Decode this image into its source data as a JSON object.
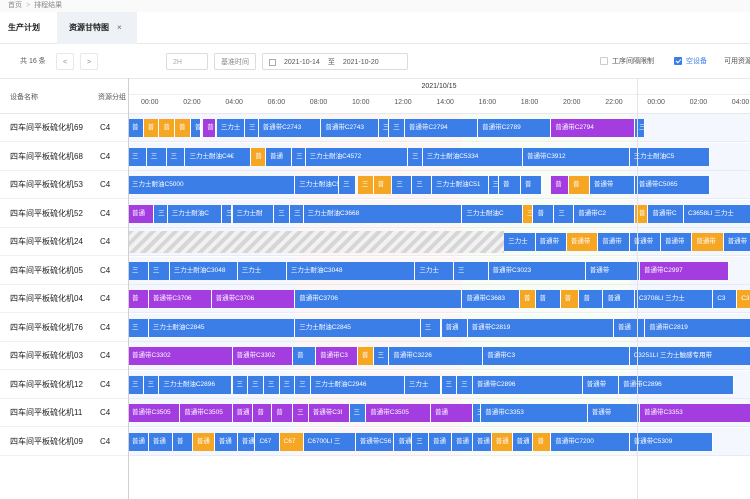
{
  "breadcrumb": {
    "home": "首页",
    "sep": ">",
    "current": "排程结果"
  },
  "tabs": [
    {
      "label": "生产计划"
    },
    {
      "label": "资源甘特图",
      "close": "×"
    }
  ],
  "toolbar": {
    "total": "共 16 条",
    "prev": "<",
    "next": ">",
    "unit": "2H",
    "base_time": "基准时间",
    "date_from": "2021-10-14",
    "to": "至",
    "date_to": "2021-10-20",
    "opt1": "工序间隔限制",
    "opt2": "空设备",
    "opt3": "可用资源"
  },
  "header": {
    "col_device": "设备名称",
    "col_group": "资源分组",
    "date": "2021/10/15",
    "hours": [
      "00:00",
      "02:00",
      "04:00",
      "06:00",
      "08:00",
      "10:00",
      "12:00",
      "14:00",
      "16:00",
      "18:00",
      "20:00",
      "22:00",
      "00:00",
      "02:00",
      "04:00"
    ]
  },
  "colors": {
    "blue": "#3b7ee8",
    "orange": "#f5a623",
    "purple": "#a43de0",
    "bg_blue": "#cfe0fb",
    "bg_pink": "#f8d8da",
    "bg_green": "#d9f0d6"
  },
  "rows": [
    {
      "device": "四车间平板硫化机69",
      "group": "C4",
      "bars": [
        {
          "s": 0,
          "e": 1.5,
          "c": "blue",
          "t": "普"
        },
        {
          "s": 1.5,
          "e": 3,
          "c": "orange",
          "t": "普"
        },
        {
          "s": 3,
          "e": 4.5,
          "c": "orange",
          "t": "普"
        },
        {
          "s": 4.5,
          "e": 6,
          "c": "orange",
          "t": "普"
        },
        {
          "s": 6,
          "e": 7,
          "c": "blue",
          "t": "普"
        },
        {
          "s": 7.2,
          "e": 8.4,
          "c": "purple",
          "t": "普"
        },
        {
          "s": 8.5,
          "e": 11.2,
          "c": "blue",
          "t": "三力士"
        },
        {
          "s": 11.2,
          "e": 12.5,
          "c": "blue",
          "t": "三"
        },
        {
          "s": 12.5,
          "e": 18.5,
          "c": "blue",
          "t": "普通带C2743"
        },
        {
          "s": 18.5,
          "e": 24,
          "c": "blue",
          "t": "普通带C2743"
        },
        {
          "s": 24,
          "e": 25,
          "c": "blue",
          "t": "三"
        },
        {
          "s": 25,
          "e": 26.5,
          "c": "blue",
          "t": "三"
        },
        {
          "s": 26.5,
          "e": 33.5,
          "c": "blue",
          "t": "普通带C2794"
        },
        {
          "s": 33.5,
          "e": 40.5,
          "c": "blue",
          "t": "普通带C2789"
        },
        {
          "s": 40.5,
          "e": 48.5,
          "c": "purple",
          "t": "普通带C2794"
        },
        {
          "s": 48.5,
          "e": 49.5,
          "c": "blue",
          "t": "三"
        }
      ]
    },
    {
      "device": "四车间平板硫化机68",
      "group": "C4",
      "bars": [
        {
          "s": 0,
          "e": 1.8,
          "c": "blue",
          "t": "三"
        },
        {
          "s": 1.8,
          "e": 3.7,
          "c": "blue",
          "t": "三"
        },
        {
          "s": 3.7,
          "e": 5.5,
          "c": "blue",
          "t": "三"
        },
        {
          "s": 5.5,
          "e": 11.8,
          "c": "blue",
          "t": "三力士耐油C4€"
        },
        {
          "s": 11.8,
          "e": 13.2,
          "c": "orange",
          "t": "普"
        },
        {
          "s": 13.2,
          "e": 15.7,
          "c": "blue",
          "t": "普通"
        },
        {
          "s": 15.7,
          "e": 17,
          "c": "blue",
          "t": "三"
        },
        {
          "s": 17,
          "e": 26.8,
          "c": "blue",
          "t": "三力士耐油C4572"
        },
        {
          "s": 26.8,
          "e": 28.2,
          "c": "blue",
          "t": "三"
        },
        {
          "s": 28.2,
          "e": 37.8,
          "c": "blue",
          "t": "三力士耐油C5334"
        },
        {
          "s": 37.8,
          "e": 48,
          "c": "blue",
          "t": "普通带C3912"
        },
        {
          "s": 48,
          "e": 55.7,
          "c": "blue",
          "t": "三力士耐油C5"
        }
      ]
    },
    {
      "device": "四车间平板硫化机53",
      "group": "C4",
      "bars": [
        {
          "s": 0,
          "e": 16,
          "c": "blue",
          "t": "三力士耐油C5000"
        },
        {
          "s": 16,
          "e": 20.2,
          "c": "blue",
          "t": "三力士耐油C50"
        },
        {
          "s": 20.2,
          "e": 21.8,
          "c": "blue",
          "t": "三"
        },
        {
          "s": 22,
          "e": 23.5,
          "c": "orange",
          "t": "三"
        },
        {
          "s": 23.5,
          "e": 25.3,
          "c": "orange",
          "t": "普"
        },
        {
          "s": 25.3,
          "e": 27.2,
          "c": "blue",
          "t": "三"
        },
        {
          "s": 27.2,
          "e": 29.1,
          "c": "blue",
          "t": "三"
        },
        {
          "s": 29.1,
          "e": 34.5,
          "c": "blue",
          "t": "三力士耐油C51"
        },
        {
          "s": 34.5,
          "e": 35.5,
          "c": "blue",
          "t": "三"
        },
        {
          "s": 35.5,
          "e": 37.6,
          "c": "blue",
          "t": "普"
        },
        {
          "s": 37.6,
          "e": 39.6,
          "c": "blue",
          "t": "普"
        },
        {
          "s": 40.5,
          "e": 42.2,
          "c": "purple",
          "t": "普"
        },
        {
          "s": 42.2,
          "e": 44.2,
          "c": "orange",
          "t": "普"
        },
        {
          "s": 44.2,
          "e": 48.5,
          "c": "blue",
          "t": "普通带"
        },
        {
          "s": 48.5,
          "e": 55.7,
          "c": "blue",
          "t": "普通带C5065"
        }
      ]
    },
    {
      "device": "四车间平板硫化机52",
      "group": "C4",
      "bars": [
        {
          "s": 0,
          "e": 2.5,
          "c": "purple",
          "t": "普通"
        },
        {
          "s": 2.5,
          "e": 3.8,
          "c": "blue",
          "t": "三"
        },
        {
          "s": 3.8,
          "e": 9,
          "c": "blue",
          "t": "三力士耐油C"
        },
        {
          "s": 9,
          "e": 10,
          "c": "blue",
          "t": "三"
        },
        {
          "s": 10,
          "e": 14,
          "c": "blue",
          "t": "三力士耐"
        },
        {
          "s": 14,
          "e": 15.5,
          "c": "blue",
          "t": "三"
        },
        {
          "s": 15.5,
          "e": 16.8,
          "c": "blue",
          "t": "三"
        },
        {
          "s": 16.8,
          "e": 32,
          "c": "blue",
          "t": "三力士耐油C3668"
        },
        {
          "s": 32,
          "e": 37.8,
          "c": "blue",
          "t": "三力士耐油C"
        },
        {
          "s": 37.8,
          "e": 38.8,
          "c": "orange",
          "t": "三"
        },
        {
          "s": 38.8,
          "e": 40.8,
          "c": "blue",
          "t": "普"
        },
        {
          "s": 40.8,
          "e": 42.7,
          "c": "blue",
          "t": "三"
        },
        {
          "s": 42.7,
          "e": 48.5,
          "c": "blue",
          "t": "普通带C2"
        },
        {
          "s": 48.5,
          "e": 49.8,
          "c": "orange",
          "t": "普"
        },
        {
          "s": 49.8,
          "e": 53.2,
          "c": "blue",
          "t": "普通带C"
        },
        {
          "s": 53.2,
          "e": 61,
          "c": "blue",
          "t": "C3658LI 三力士"
        }
      ]
    },
    {
      "device": "四车间平板硫化机24",
      "group": "C4",
      "hatch": [
        0,
        36
      ],
      "bars": [
        {
          "s": 36,
          "e": 39,
          "c": "blue",
          "t": "三力士"
        },
        {
          "s": 39,
          "e": 42,
          "c": "blue",
          "t": "普通带"
        },
        {
          "s": 42,
          "e": 45,
          "c": "orange",
          "t": "普通带"
        },
        {
          "s": 45,
          "e": 48,
          "c": "blue",
          "t": "普通带"
        },
        {
          "s": 48,
          "e": 51,
          "c": "blue",
          "t": "普通带"
        },
        {
          "s": 51,
          "e": 54,
          "c": "blue",
          "t": "普通带"
        },
        {
          "s": 54,
          "e": 57,
          "c": "orange",
          "t": "普通带"
        },
        {
          "s": 57,
          "e": 60,
          "c": "blue",
          "t": "普通带"
        }
      ]
    },
    {
      "device": "四车间平板硫化机05",
      "group": "C4",
      "bars": [
        {
          "s": 0,
          "e": 2,
          "c": "blue",
          "t": "三"
        },
        {
          "s": 2,
          "e": 4,
          "c": "blue",
          "t": "三"
        },
        {
          "s": 4,
          "e": 10.5,
          "c": "blue",
          "t": "三力士耐油C3048"
        },
        {
          "s": 10.5,
          "e": 15.2,
          "c": "blue",
          "t": "三力士"
        },
        {
          "s": 15.2,
          "e": 27.5,
          "c": "blue",
          "t": "三力士耐油C3048"
        },
        {
          "s": 27.5,
          "e": 31.2,
          "c": "blue",
          "t": "三力士"
        },
        {
          "s": 31.2,
          "e": 34.5,
          "c": "blue",
          "t": "三"
        },
        {
          "s": 34.5,
          "e": 43.8,
          "c": "blue",
          "t": "普通带C3023"
        },
        {
          "s": 43.8,
          "e": 49,
          "c": "blue",
          "t": "普通带"
        },
        {
          "s": 49,
          "e": 57.5,
          "c": "purple",
          "t": "普通带C2997"
        }
      ]
    },
    {
      "device": "四车间平板硫化机04",
      "group": "C4",
      "bars": [
        {
          "s": 0,
          "e": 2,
          "c": "purple",
          "t": "普"
        },
        {
          "s": 2,
          "e": 8,
          "c": "purple",
          "t": "普通带C3706"
        },
        {
          "s": 8,
          "e": 16,
          "c": "purple",
          "t": "普通带C3706"
        },
        {
          "s": 16,
          "e": 32,
          "c": "blue",
          "t": "普通带C3706"
        },
        {
          "s": 32,
          "e": 37.5,
          "c": "blue",
          "t": "普通带C3683"
        },
        {
          "s": 37.5,
          "e": 39,
          "c": "orange",
          "t": "普"
        },
        {
          "s": 39,
          "e": 41.4,
          "c": "blue",
          "t": "普"
        },
        {
          "s": 41.4,
          "e": 43.2,
          "c": "orange",
          "t": "普"
        },
        {
          "s": 43.2,
          "e": 45.5,
          "c": "blue",
          "t": "普"
        },
        {
          "s": 45.5,
          "e": 48.5,
          "c": "blue",
          "t": "普通"
        },
        {
          "s": 48.5,
          "e": 56,
          "c": "blue",
          "t": "C3708LI 三力士"
        },
        {
          "s": 56,
          "e": 58.3,
          "c": "blue",
          "t": "C3"
        },
        {
          "s": 58.3,
          "e": 61,
          "c": "orange",
          "t": "C3"
        }
      ]
    },
    {
      "device": "四车间平板硫化机76",
      "group": "C4",
      "bars": [
        {
          "s": 0,
          "e": 2,
          "c": "blue",
          "t": "三"
        },
        {
          "s": 2,
          "e": 16,
          "c": "blue",
          "t": "三力士耐油C2845"
        },
        {
          "s": 16,
          "e": 28,
          "c": "blue",
          "t": "三力士耐油C2845"
        },
        {
          "s": 28,
          "e": 30,
          "c": "blue",
          "t": "三"
        },
        {
          "s": 30,
          "e": 32.5,
          "c": "blue",
          "t": "普通"
        },
        {
          "s": 32.5,
          "e": 46.5,
          "c": "blue",
          "t": "普通带C2819"
        },
        {
          "s": 46.5,
          "e": 49.5,
          "c": "blue",
          "t": "普通"
        },
        {
          "s": 49.5,
          "e": 61,
          "c": "blue",
          "t": "普通带C2819"
        }
      ]
    },
    {
      "device": "四车间平板硫化机03",
      "group": "C4",
      "bars": [
        {
          "s": 0,
          "e": 10,
          "c": "purple",
          "t": "普通带C3302"
        },
        {
          "s": 10,
          "e": 15.8,
          "c": "purple",
          "t": "普通带C3302"
        },
        {
          "s": 15.8,
          "e": 18,
          "c": "blue",
          "t": "普"
        },
        {
          "s": 18,
          "e": 22,
          "c": "purple",
          "t": "普通带C3"
        },
        {
          "s": 22,
          "e": 23.5,
          "c": "orange",
          "t": "普"
        },
        {
          "s": 23.5,
          "e": 25,
          "c": "blue",
          "t": "三"
        },
        {
          "s": 25,
          "e": 34,
          "c": "blue",
          "t": "普通带C3226"
        },
        {
          "s": 34,
          "e": 48,
          "c": "blue",
          "t": "普通带C3"
        },
        {
          "s": 48,
          "e": 61,
          "c": "blue",
          "t": "C3251LI 三力士触感专用带"
        }
      ]
    },
    {
      "device": "四车间平板硫化机12",
      "group": "C4",
      "bars": [
        {
          "s": 0,
          "e": 1.5,
          "c": "blue",
          "t": "三"
        },
        {
          "s": 1.5,
          "e": 3,
          "c": "blue",
          "t": "三"
        },
        {
          "s": 3,
          "e": 10,
          "c": "blue",
          "t": "三力士耐油C2896"
        },
        {
          "s": 10,
          "e": 11.5,
          "c": "blue",
          "t": "三"
        },
        {
          "s": 11.5,
          "e": 13,
          "c": "blue",
          "t": "三"
        },
        {
          "s": 13,
          "e": 14.5,
          "c": "blue",
          "t": "三"
        },
        {
          "s": 14.5,
          "e": 16,
          "c": "blue",
          "t": "三"
        },
        {
          "s": 16,
          "e": 17.5,
          "c": "blue",
          "t": "三"
        },
        {
          "s": 17.5,
          "e": 26.5,
          "c": "blue",
          "t": "三力士耐油C2946"
        },
        {
          "s": 26.5,
          "e": 30,
          "c": "blue",
          "t": "三力士"
        },
        {
          "s": 30,
          "e": 31.5,
          "c": "blue",
          "t": "三"
        },
        {
          "s": 31.5,
          "e": 33,
          "c": "blue",
          "t": "三"
        },
        {
          "s": 33,
          "e": 43.5,
          "c": "blue",
          "t": "普通带C2896"
        },
        {
          "s": 43.5,
          "e": 47,
          "c": "blue",
          "t": "普通带"
        },
        {
          "s": 47,
          "e": 58,
          "c": "blue",
          "t": "普通带C2896"
        }
      ]
    },
    {
      "device": "四车间平板硫化机11",
      "group": "C4",
      "bars": [
        {
          "s": 0,
          "e": 5,
          "c": "purple",
          "t": "普通带C3505"
        },
        {
          "s": 5,
          "e": 10,
          "c": "purple",
          "t": "普通带C3505"
        },
        {
          "s": 10,
          "e": 12,
          "c": "purple",
          "t": "普通"
        },
        {
          "s": 12,
          "e": 13.8,
          "c": "purple",
          "t": "普"
        },
        {
          "s": 13.8,
          "e": 15.8,
          "c": "purple",
          "t": "普"
        },
        {
          "s": 15.8,
          "e": 17.3,
          "c": "purple",
          "t": "三"
        },
        {
          "s": 17.3,
          "e": 21.2,
          "c": "purple",
          "t": "普通带C3I"
        },
        {
          "s": 21.2,
          "e": 22.8,
          "c": "blue",
          "t": "三"
        },
        {
          "s": 22.8,
          "e": 29,
          "c": "purple",
          "t": "普通带C3505"
        },
        {
          "s": 29,
          "e": 33,
          "c": "purple",
          "t": "普通"
        },
        {
          "s": 33,
          "e": 33.8,
          "c": "blue",
          "t": "三"
        },
        {
          "s": 33.8,
          "e": 44,
          "c": "blue",
          "t": "普通带C3353"
        },
        {
          "s": 44,
          "e": 49,
          "c": "blue",
          "t": "普通带"
        },
        {
          "s": 49,
          "e": 61,
          "c": "purple",
          "t": "普通带C3353"
        }
      ]
    },
    {
      "device": "四车间平板硫化机09",
      "group": "C4",
      "bars": [
        {
          "s": 0,
          "e": 2,
          "c": "blue",
          "t": "普通"
        },
        {
          "s": 2,
          "e": 4.3,
          "c": "blue",
          "t": "普通"
        },
        {
          "s": 4.3,
          "e": 6.2,
          "c": "blue",
          "t": "普"
        },
        {
          "s": 6.2,
          "e": 8.3,
          "c": "orange",
          "t": "普通"
        },
        {
          "s": 8.3,
          "e": 10.5,
          "c": "blue",
          "t": "普通"
        },
        {
          "s": 10.5,
          "e": 12.2,
          "c": "blue",
          "t": "普通"
        },
        {
          "s": 12.2,
          "e": 14.5,
          "c": "blue",
          "t": "C67"
        },
        {
          "s": 14.5,
          "e": 16.8,
          "c": "orange",
          "t": "C67"
        },
        {
          "s": 16.8,
          "e": 21.8,
          "c": "blue",
          "t": "C6700LI 三"
        },
        {
          "s": 21.8,
          "e": 25.5,
          "c": "blue",
          "t": "普通带C56"
        },
        {
          "s": 25.5,
          "e": 27.2,
          "c": "blue",
          "t": "普通"
        },
        {
          "s": 27.2,
          "e": 28.8,
          "c": "blue",
          "t": "三"
        },
        {
          "s": 28.8,
          "e": 31,
          "c": "blue",
          "t": "普通"
        },
        {
          "s": 31,
          "e": 33,
          "c": "blue",
          "t": "普通"
        },
        {
          "s": 33,
          "e": 34.8,
          "c": "blue",
          "t": "普通"
        },
        {
          "s": 34.8,
          "e": 36.8,
          "c": "orange",
          "t": "普通"
        },
        {
          "s": 36.8,
          "e": 38.8,
          "c": "blue",
          "t": "普通"
        },
        {
          "s": 38.8,
          "e": 40.5,
          "c": "orange",
          "t": "普"
        },
        {
          "s": 40.5,
          "e": 48,
          "c": "blue",
          "t": "普通带C7200"
        },
        {
          "s": 48,
          "e": 56,
          "c": "blue",
          "t": "普通带C5309"
        }
      ]
    }
  ]
}
